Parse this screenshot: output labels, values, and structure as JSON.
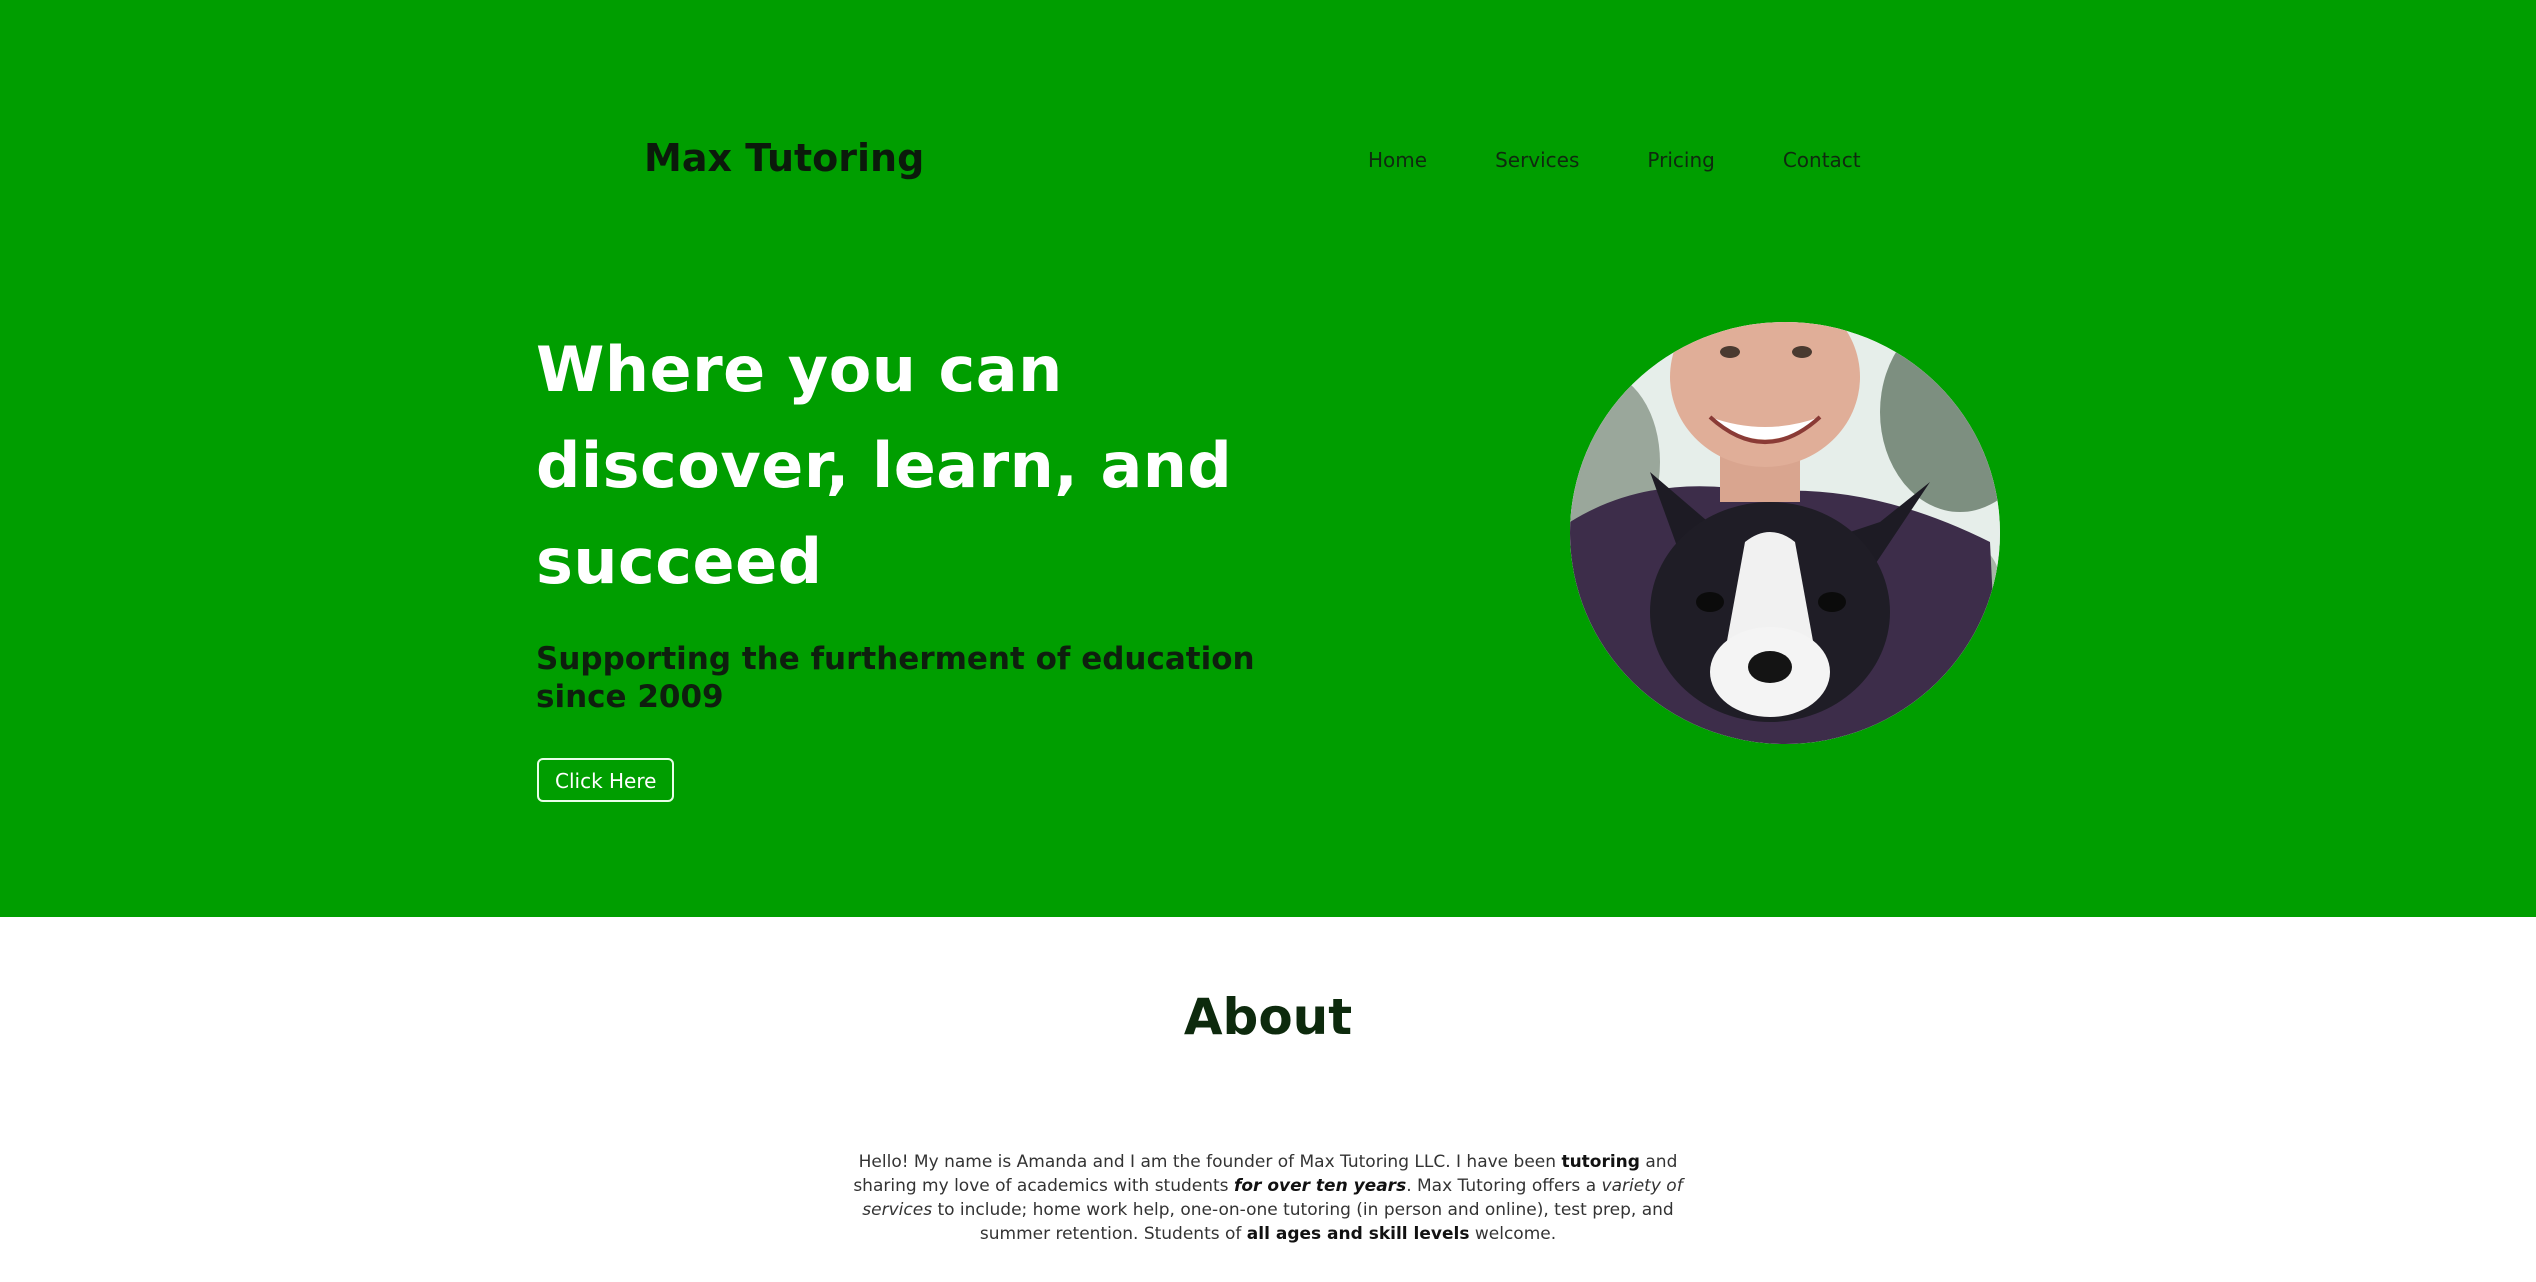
{
  "brand": {
    "name": "Max Tutoring"
  },
  "nav": {
    "items": [
      {
        "label": "Home"
      },
      {
        "label": "Services"
      },
      {
        "label": "Pricing"
      },
      {
        "label": "Contact"
      }
    ]
  },
  "hero": {
    "headline": "Where you can discover, learn, and succeed",
    "subheadline": "Supporting the furtherment of education since 2009",
    "cta_label": "Click Here",
    "photo_description_icon": "founder-with-dog-photo"
  },
  "about": {
    "title": "About",
    "paragraph": [
      {
        "text": "Hello! My name is Amanda and I am the founder of Max Tutoring LLC. I have been ",
        "style": "normal"
      },
      {
        "text": "tutoring",
        "style": "bold"
      },
      {
        "text": " and sharing my love of academics with students ",
        "style": "normal"
      },
      {
        "text": "for over ten years",
        "style": "bolditalic"
      },
      {
        "text": ". Max Tutoring offers a ",
        "style": "normal"
      },
      {
        "text": "variety of services",
        "style": "italic"
      },
      {
        "text": " to include; home work help, one-on-one tutoring (in person and online), test prep, and summer retention. Students of ",
        "style": "normal"
      },
      {
        "text": "all ages and skill levels",
        "style": "bold"
      },
      {
        "text": " welcome.",
        "style": "normal"
      }
    ]
  },
  "colors": {
    "hero_background": "#009e00",
    "headline": "#ffffff",
    "about_title": "#0d2a0d"
  }
}
